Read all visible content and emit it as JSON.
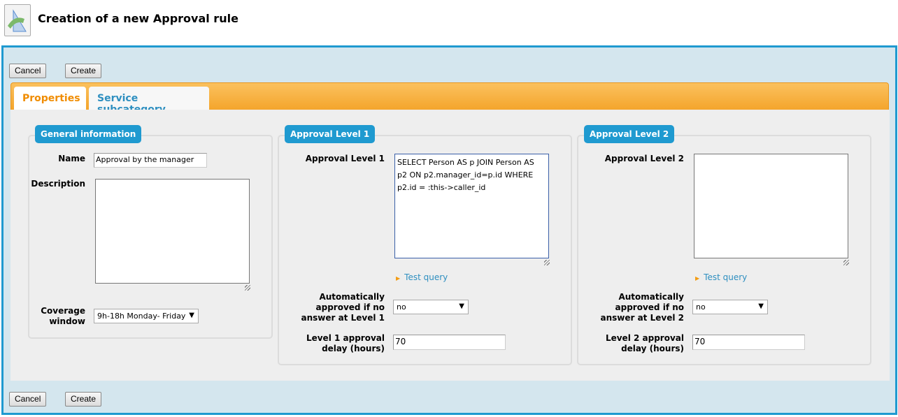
{
  "header": {
    "title": "Creation of a new Approval rule",
    "icon": "approval-rule-icon"
  },
  "toolbar": {
    "cancel_label": "Cancel",
    "create_label": "Create"
  },
  "tabs": [
    {
      "label": "Properties",
      "active": true
    },
    {
      "label": "Service subcategory",
      "active": false
    }
  ],
  "general": {
    "legend": "General information",
    "name_label": "Name",
    "name_value": "Approval by the manager",
    "description_label": "Description",
    "description_value": "",
    "coverage_label": "Coverage window",
    "coverage_value": "9h-18h Monday- Friday"
  },
  "level1": {
    "legend": "Approval Level 1",
    "query_label": "Approval Level 1",
    "query_value": "SELECT Person AS p JOIN Person AS p2 ON p2.manager_id=p.id WHERE p2.id = :this->caller_id",
    "test_query": "Test query",
    "auto_label": "Automatically approved if no answer at Level 1",
    "auto_value": "no",
    "delay_label": "Level 1 approval delay (hours)",
    "delay_value": "70"
  },
  "level2": {
    "legend": "Approval Level 2",
    "query_label": "Approval Level 2",
    "query_value": "",
    "test_query": "Test query",
    "auto_label": "Automatically approved if no answer at Level 2",
    "auto_value": "no",
    "delay_label": "Level 2 approval delay (hours)",
    "delay_value": "70"
  },
  "colors": {
    "accent": "#1f9ad0",
    "tab_bar": "#f4a52c",
    "active_tab_text": "#f08c00"
  }
}
